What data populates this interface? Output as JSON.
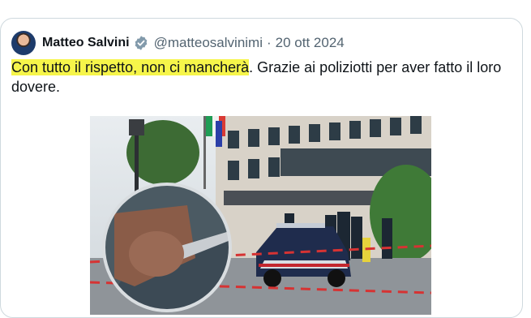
{
  "tweet": {
    "author_name": "Matteo Salvini",
    "handle": "@matteosalvinimi",
    "separator": "·",
    "date": "20 ott 2024",
    "text_highlighted": "Con tutto il rispetto, non ci mancherà",
    "text_rest": ". Grazie ai poliziotti per aver fatto il loro dovere.",
    "highlight_color": "#f6f54a",
    "verified_badge_color": "#829aab"
  },
  "icons": {
    "verified": "verified-badge-icon"
  }
}
